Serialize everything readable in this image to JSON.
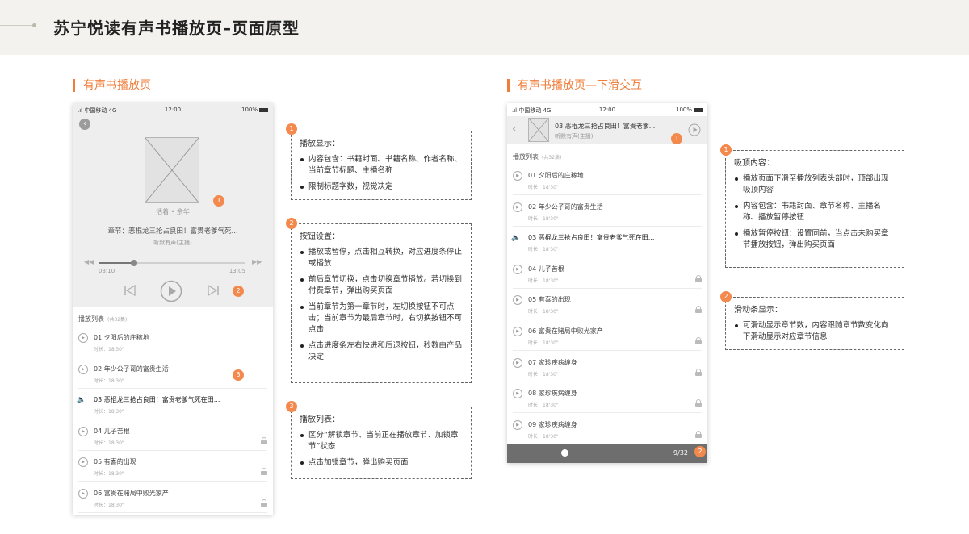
{
  "header": {
    "title": "苏宁悦读有声书播放页–页面原型"
  },
  "sections": {
    "left_title": "有声书播放页",
    "right_title": "有声书播放页—下滑交互"
  },
  "status_bar": {
    "carrier": ".ıl 中国移动 4G",
    "time": "12:00",
    "battery": "100%"
  },
  "player": {
    "book_meta": "活着 • 余华",
    "chapter_label": "章节：恶棍龙三抢占良田！富贵老爹气死...",
    "host": "听默有声(主播)",
    "current_time": "03:10",
    "total_time": "13:05",
    "progress_fraction": 0.24
  },
  "playlist": {
    "header": "播放列表",
    "count": "(共32集)",
    "duration_label": "时长：18'30\"",
    "items": [
      {
        "num": "01",
        "title": "夕阳后的庄稼地",
        "locked": false
      },
      {
        "num": "02",
        "title": "年少公子哥的富贵生活",
        "locked": false
      },
      {
        "num": "03",
        "title": "恶棍龙三抢占良田！富贵老爹气死在田...",
        "locked": false,
        "current": true
      },
      {
        "num": "04",
        "title": "儿子苦根",
        "locked": true
      },
      {
        "num": "05",
        "title": "有喜的出现",
        "locked": true
      },
      {
        "num": "06",
        "title": "富贵在赌局中败光家产",
        "locked": true
      },
      {
        "num": "07",
        "title": "家珍疾病缠身",
        "locked": true
      },
      {
        "num": "08",
        "title": "家珍疾病缠身",
        "locked": true
      },
      {
        "num": "09",
        "title": "家珍疾病缠身",
        "locked": true
      }
    ]
  },
  "sticky_header": {
    "title": "03 恶棍龙三抢占良田！富贵老爹...",
    "host": "听默有声(主播)"
  },
  "scrubber": {
    "counter": "9/32",
    "fraction": 0.28
  },
  "notes_left": [
    {
      "num": "1",
      "title": "播放显示：",
      "items": [
        "内容包含：书籍封面、书籍名称、作者名称、当前章节标题、主播名称",
        "限制标题字数，视觉决定"
      ]
    },
    {
      "num": "2",
      "title": "按钮设置：",
      "items": [
        "播放或暂停，点击相互转换，对应进度条停止或播放",
        "前后章节切换，点击切换章节播放。若切换到付费章节，弹出购买页面",
        "当前章节为第一章节时，左切换按钮不可点击；当前章节为最后章节时，右切换按钮不可点击",
        "点击进度条左右快进和后退按钮，秒数由产品决定"
      ]
    },
    {
      "num": "3",
      "title": "播放列表：",
      "items": [
        "区分“解锁章节、当前正在播放章节、加锁章节”状态",
        "点击加锁章节，弹出购买页面"
      ]
    }
  ],
  "notes_right": [
    {
      "num": "1",
      "title": "吸顶内容：",
      "items": [
        "播放页面下滑至播放列表头部时，顶部出现吸顶内容",
        "内容包含：书籍封面、章节名称、主播名称、播放暂停按钮",
        "播放暂停按钮：设置同前，当点击未购买章节播放按钮，弹出购买页面"
      ]
    },
    {
      "num": "2",
      "title": "滑动条显示：",
      "items": [
        "可滑动显示章节数，内容跟随章节数变化向下滑动显示对应章节信息"
      ]
    }
  ],
  "badges": [
    "1",
    "2",
    "3"
  ],
  "colors": {
    "accent": "#f07d3a",
    "badge": "#f3894d"
  },
  "icons": {
    "back": "chevron-left-circle-icon",
    "prev": "skip-previous-icon",
    "play": "play-circle-icon",
    "next": "skip-next-icon",
    "rewind": "rewind-icon",
    "forward": "fast-forward-icon",
    "lock": "lock-icon",
    "speaker": "speaker-icon"
  }
}
